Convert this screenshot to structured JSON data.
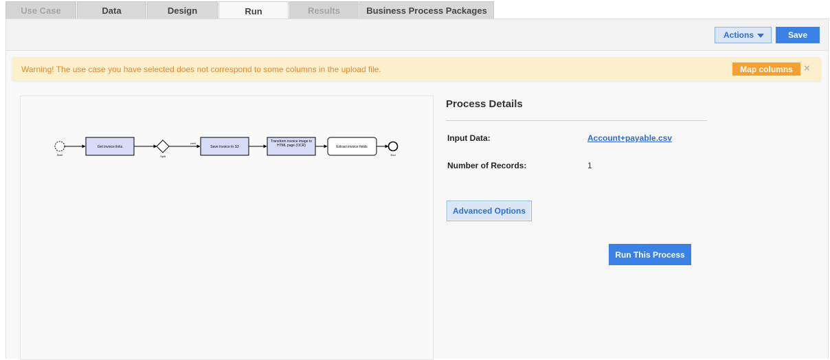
{
  "tabs": [
    {
      "label": "Use Case",
      "state": "disabled"
    },
    {
      "label": "Data",
      "state": "normal"
    },
    {
      "label": "Design",
      "state": "normal"
    },
    {
      "label": "Run",
      "state": "active"
    },
    {
      "label": "Results",
      "state": "disabled"
    },
    {
      "label": "Business Process Packages",
      "state": "normal"
    }
  ],
  "toolbar": {
    "actions_label": "Actions",
    "save_label": "Save"
  },
  "warning": {
    "text": "Warning! The use case you have selected does not correspond to some columns in the upload file.",
    "map_columns_label": "Map columns",
    "close_glyph": "×"
  },
  "process_diagram": {
    "nodes": [
      {
        "type": "start-event",
        "label": "Start"
      },
      {
        "type": "task",
        "label": "Get invoice links"
      },
      {
        "type": "gateway",
        "label": "Split"
      },
      {
        "type": "task",
        "label": "Save invoice to S3"
      },
      {
        "type": "task",
        "label": "Transform invoice image to HTML page (OCR)"
      },
      {
        "type": "task",
        "label": "Extract invoice fields"
      },
      {
        "type": "end-event",
        "label": "End"
      }
    ],
    "edge_label": "next"
  },
  "details": {
    "title": "Process Details",
    "input_data_label": "Input Data:",
    "input_data_value": "Account+payable.csv",
    "records_label": "Number of Records:",
    "records_value": "1",
    "advanced_options_label": "Advanced Options",
    "run_label": "Run This Process"
  },
  "colors": {
    "accent": "#3b82e6",
    "warning_bg": "#fcefcc",
    "warning_text": "#e8862a",
    "warning_button": "#f5a030",
    "task_fill": "#d6dcf8"
  }
}
